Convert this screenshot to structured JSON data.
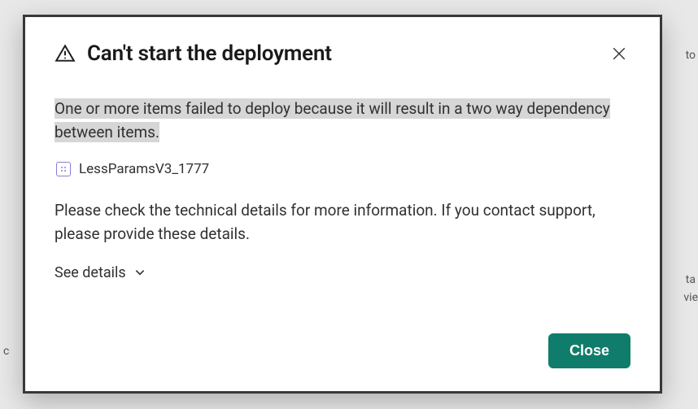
{
  "dialog": {
    "title": "Can't start the deployment",
    "summary": "One or more items failed to deploy because it will result in a two way dependency between items.",
    "item_name": "LessParamsV3_1777",
    "instruction": "Please check the technical details for more information. If you contact support, please provide these details.",
    "see_details_label": "See details",
    "close_button_label": "Close"
  },
  "background_fragments": {
    "right_top": "to",
    "right_mid1": "ta",
    "right_mid2": "vie",
    "left_mid": "c"
  }
}
